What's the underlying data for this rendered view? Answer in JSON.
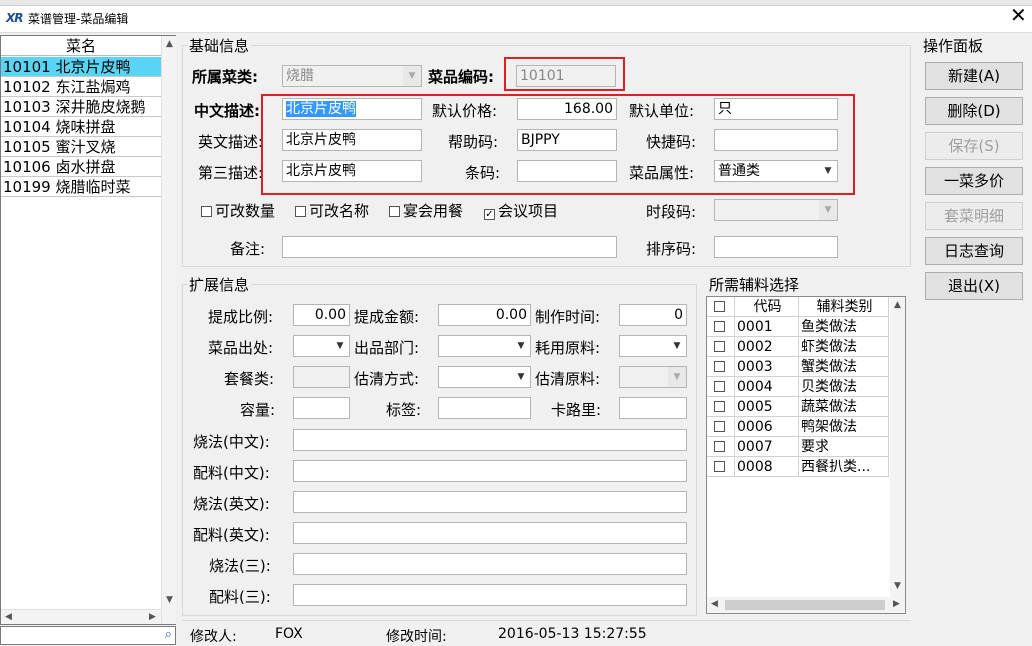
{
  "window": {
    "logo": "XR",
    "title": "菜谱管理-菜品编辑",
    "close": "✕"
  },
  "dish_list": {
    "header": "菜名",
    "rows": [
      {
        "text": "10101 北京片皮鸭",
        "selected": true
      },
      {
        "text": "10102 东江盐焗鸡"
      },
      {
        "text": "10103 深井脆皮烧鹅"
      },
      {
        "text": "10104 烧味拼盘"
      },
      {
        "text": "10105 蜜汁叉烧"
      },
      {
        "text": "10106 卤水拼盘"
      },
      {
        "text": "10199 烧腊临时菜"
      }
    ],
    "search_icon": "search-icon"
  },
  "basic": {
    "group_label": "基础信息",
    "category_label": "所属菜类:",
    "category_value": "烧腊",
    "code_label": "菜品编码:",
    "code_value": "10101",
    "cn_desc_label": "中文描述:",
    "cn_desc_value": "北京片皮鸭",
    "price_label": "默认价格:",
    "price_value": "168.00",
    "unit_label": "默认单位:",
    "unit_value": "只",
    "en_desc_label": "英文描述:",
    "en_desc_value": "北京片皮鸭",
    "help_code_label": "帮助码:",
    "help_code_value": "BJPPY",
    "shortcut_label": "快捷码:",
    "shortcut_value": "",
    "third_desc_label": "第三描述:",
    "third_desc_value": "北京片皮鸭",
    "barcode_label": "条码:",
    "barcode_value": "",
    "attr_label": "菜品属性:",
    "attr_value": "普通类",
    "checks": [
      {
        "label": "可改数量",
        "checked": false
      },
      {
        "label": "可改名称",
        "checked": false
      },
      {
        "label": "宴会用餐",
        "checked": false
      },
      {
        "label": "会议项目",
        "checked": true
      }
    ],
    "period_label": "时段码:",
    "period_value": "",
    "remark_label": "备注:",
    "remark_value": "",
    "sort_label": "排序码:",
    "sort_value": ""
  },
  "extended": {
    "group_label": "扩展信息",
    "commission_rate_label": "提成比例:",
    "commission_rate_value": "0.00",
    "commission_amount_label": "提成金额:",
    "commission_amount_value": "0.00",
    "make_time_label": "制作时间:",
    "make_time_value": "0",
    "dish_out_label": "菜品出处:",
    "out_dept_label": "出品部门:",
    "material_label": "耗用原料:",
    "set_label": "套餐类:",
    "estimate_label": "估清方式:",
    "estimate_material_label": "估清原料:",
    "capacity_label": "容量:",
    "tag_label": "标签:",
    "calorie_label": "卡路里:",
    "text_fields": [
      {
        "label": "烧法(中文):",
        "value": ""
      },
      {
        "label": "配料(中文):",
        "value": ""
      },
      {
        "label": "烧法(英文):",
        "value": ""
      },
      {
        "label": "配料(英文):",
        "value": ""
      },
      {
        "label": "烧法(三):",
        "value": ""
      },
      {
        "label": "配料(三):",
        "value": ""
      }
    ]
  },
  "aux": {
    "group_label": "所需辅料选择",
    "col_code": "代码",
    "col_type": "辅料类别",
    "rows": [
      {
        "code": "0001",
        "type": "鱼类做法"
      },
      {
        "code": "0002",
        "type": "虾类做法"
      },
      {
        "code": "0003",
        "type": "蟹类做法"
      },
      {
        "code": "0004",
        "type": "贝类做法"
      },
      {
        "code": "0005",
        "type": "蔬菜做法"
      },
      {
        "code": "0006",
        "type": "鸭架做法"
      },
      {
        "code": "0007",
        "type": "要求"
      },
      {
        "code": "0008",
        "type": "西餐扒类..."
      }
    ]
  },
  "ops": {
    "group_label": "操作面板",
    "buttons": [
      {
        "label": "新建(A)",
        "enabled": true
      },
      {
        "label": "删除(D)",
        "enabled": true
      },
      {
        "label": "保存(S)",
        "enabled": false
      },
      {
        "label": "一菜多价",
        "enabled": true
      },
      {
        "label": "套菜明细",
        "enabled": false
      },
      {
        "label": "日志查询",
        "enabled": true
      },
      {
        "label": "退出(X)",
        "enabled": true
      }
    ]
  },
  "status": {
    "modifier_label": "修改人:",
    "modifier_value": "FOX",
    "time_label": "修改时间:",
    "time_value": "2016-05-13 15:27:55"
  },
  "colors": {
    "selection": "#5ad4f4",
    "highlight": "#3399ff",
    "annotation": "#e02020"
  }
}
